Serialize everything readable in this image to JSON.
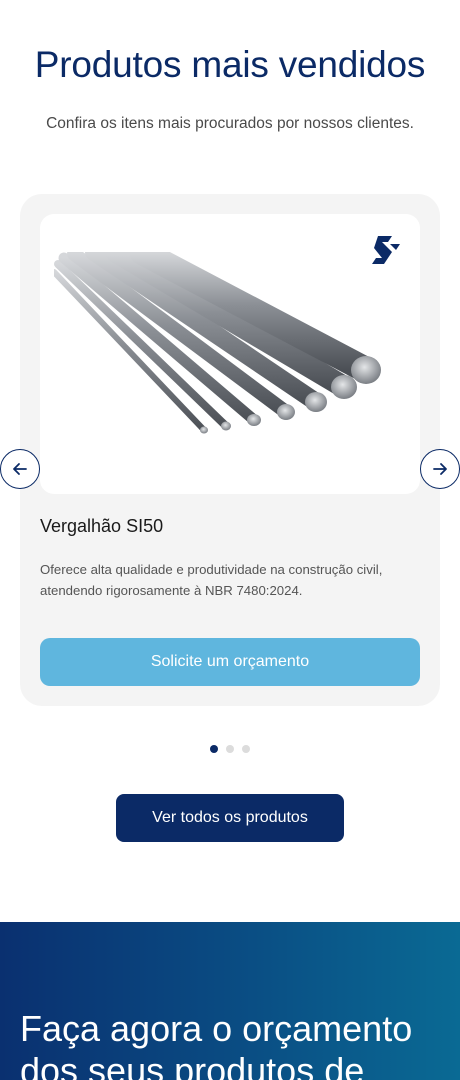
{
  "section": {
    "title": "Produtos mais vendidos",
    "subtitle": "Confira os itens mais procurados por nossos clientes."
  },
  "carousel": {
    "prev_icon": "arrow-left-icon",
    "next_icon": "arrow-right-icon",
    "current_index": 1,
    "total": 3,
    "item": {
      "brand_icon": "brand-logo-icon",
      "image": "rebar-bundle-image",
      "title": "Vergalhão SI50",
      "description": "Oferece alta qualidade e produtividade na construção civil, atendendo rigorosamente à NBR 7480:2024.",
      "button_label": "Solicite um orçamento"
    }
  },
  "actions": {
    "all_products_label": "Ver todos os produtos"
  },
  "cta": {
    "title": "Faça agora o orçamento dos seus produtos de"
  },
  "colors": {
    "primary": "#0b2a66",
    "accent": "#5fb6de",
    "card_bg": "#f4f4f4"
  }
}
